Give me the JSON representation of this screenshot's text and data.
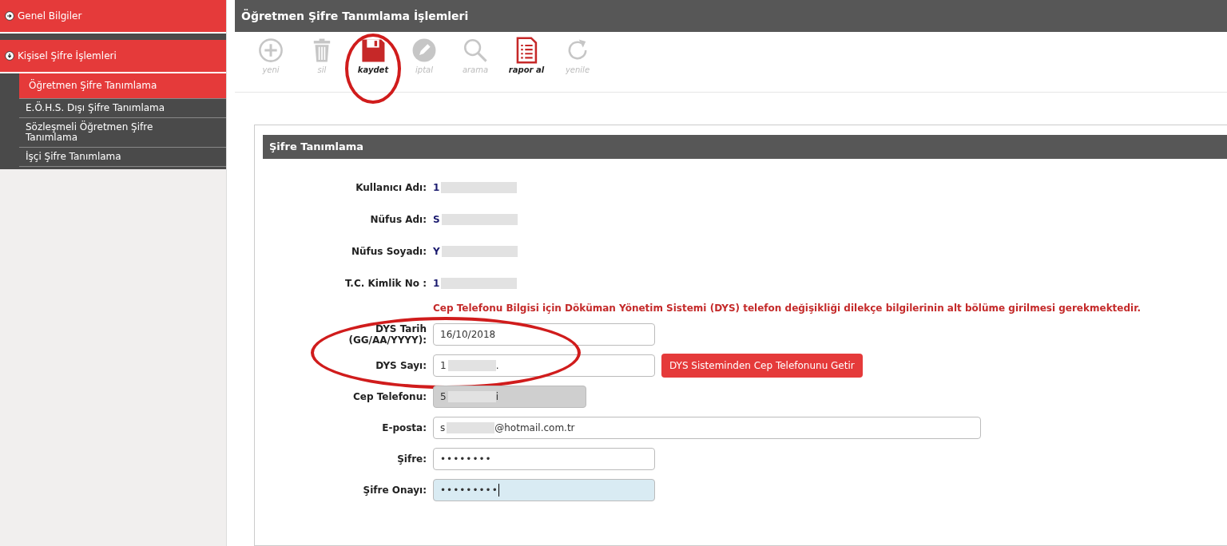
{
  "sidebar": {
    "items": [
      {
        "label": "Genel Bilgiler",
        "expanded": false
      },
      {
        "label": "Kişisel Şifre İşlemleri",
        "expanded": true,
        "children": [
          {
            "label": "Öğretmen Şifre Tanımlama",
            "selected": true
          },
          {
            "label": "E.Ö.H.S. Dışı Şifre Tanımlama",
            "selected": false
          },
          {
            "label": "Sözleşmeli Öğretmen Şifre Tanımlama",
            "selected": false
          },
          {
            "label": "İşçi Şifre Tanımlama",
            "selected": false
          }
        ]
      }
    ]
  },
  "page_title": "Öğretmen Şifre Tanımlama İşlemleri",
  "toolbar": [
    {
      "kind": "plus",
      "label": "yeni",
      "disabled": true
    },
    {
      "kind": "trash",
      "label": "sil",
      "disabled": true
    },
    {
      "kind": "save",
      "label": "kaydet",
      "disabled": false,
      "circled": true
    },
    {
      "kind": "pencil",
      "label": "iptal",
      "disabled": true
    },
    {
      "kind": "search",
      "label": "arama",
      "disabled": true
    },
    {
      "kind": "report",
      "label": "rapor al",
      "disabled": false
    },
    {
      "kind": "refresh",
      "label": "yenile",
      "disabled": true
    }
  ],
  "panel": {
    "title": "Şifre Tanımlama",
    "info": [
      {
        "label": "Kullanıcı Adı:",
        "value": "1",
        "redacted": true
      },
      {
        "label": "Nüfus Adı:",
        "value": "S",
        "redacted": true
      },
      {
        "label": "Nüfus Soyadı:",
        "value": "Y",
        "redacted": true
      },
      {
        "label": "T.C. Kimlik No :",
        "value": "1",
        "redacted": true
      }
    ],
    "notice": "Cep Telefonu Bilgisi için Döküman Yönetim Sistemi (DYS) telefon değişikliği dilekçe bilgilerinin alt bölüme girilmesi gerekmektedir.",
    "groups": [
      {
        "circled": true,
        "fields": [
          {
            "kind": "date",
            "label": "DYS Tarih (GG/AA/YYYY):",
            "value": "16/10/2018",
            "disabled": false,
            "focused": false
          },
          {
            "kind": "number",
            "label": "DYS Sayı:",
            "value": "1",
            "value_end": ".",
            "redacted": true,
            "disabled": false,
            "focused": false,
            "button": "DYS Sisteminden Cep Telefonunu Getir"
          }
        ]
      },
      {
        "fields": [
          {
            "kind": "phone",
            "label": "Cep Telefonu:",
            "value": "5",
            "value_end": "i",
            "redacted": true,
            "disabled": true,
            "focused": false
          },
          {
            "kind": "email",
            "label": "E-posta:",
            "value": "s",
            "value_end": "@hotmail.com.tr",
            "redacted": true,
            "disabled": false,
            "focused": false
          },
          {
            "kind": "password",
            "label": "Şifre:",
            "value": "••••••••",
            "disabled": false,
            "focused": false
          },
          {
            "kind": "password",
            "label": "Şifre Onayı:",
            "value": "•••••••••",
            "disabled": false,
            "focused": true
          }
        ]
      }
    ]
  }
}
